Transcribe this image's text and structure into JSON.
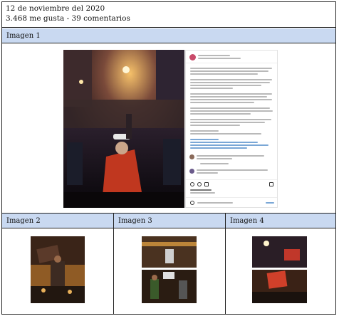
{
  "header": {
    "date": "12 de noviembre del 2020",
    "stats": "3.468 me gusta - 39 comentarios"
  },
  "sections": {
    "image1_label": "Imagen 1",
    "image2_label": "Imagen 2",
    "image3_label": "Imagen 3",
    "image4_label": "Imagen 4"
  },
  "colors": {
    "label_bg": "#c9d9f1",
    "border": "#222222"
  }
}
